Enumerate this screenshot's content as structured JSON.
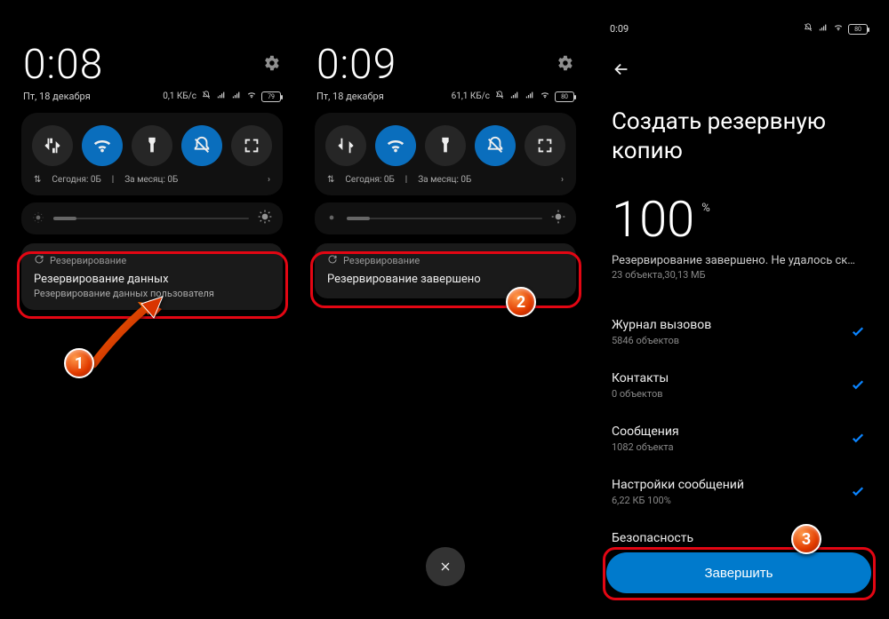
{
  "phone1": {
    "status_time": "",
    "clock": "0:08",
    "date": "Пт, 18 декабря",
    "speed": "0,1 КБ/с",
    "battery": "79",
    "usage_arrow": "⇅",
    "usage_today": "Сегодня: 0Б",
    "usage_sep": "|",
    "usage_month": "За месяц: 0Б",
    "notif_app": "Резервирование",
    "notif_title": "Резервирование данных",
    "notif_sub": "Резервирование данных пользователя"
  },
  "phone2": {
    "clock": "0:09",
    "date": "Пт, 18 декабря",
    "speed": "61,1 КБ/с",
    "battery": "80",
    "usage_arrow": "⇅",
    "usage_today": "Сегодня: 0Б",
    "usage_sep": "|",
    "usage_month": "За месяц: 0Б",
    "notif_app": "Резервирование",
    "notif_title": "Резервирование завершено"
  },
  "phone3": {
    "status_time": "0:09",
    "battery": "80",
    "title": "Создать резервную копию",
    "progress": "100",
    "percent_sign": "%",
    "status": "Резервирование завершено. Не удалось ск…",
    "summary": "23 объекта,30,13 МБ",
    "items": [
      {
        "title": "Журнал вызовов",
        "sub": "5846 объектов"
      },
      {
        "title": "Контакты",
        "sub": "0 объектов"
      },
      {
        "title": "Сообщения",
        "sub": "1082 объекта"
      },
      {
        "title": "Настройки сообщений",
        "sub": "6,22 КБ 100%"
      },
      {
        "title": "Безопасность",
        "sub": ""
      }
    ],
    "finish": "Завершить"
  },
  "badges": {
    "one": "1",
    "two": "2",
    "three": "3"
  }
}
